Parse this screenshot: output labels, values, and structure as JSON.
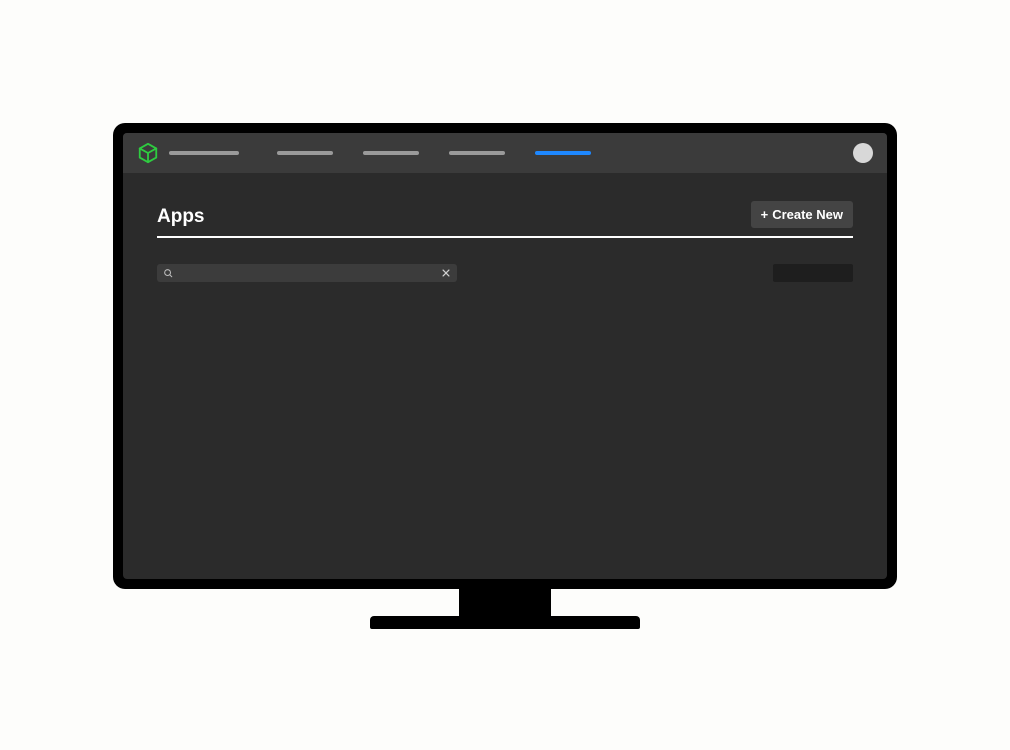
{
  "nav": {
    "items": [
      {
        "active": false
      },
      {
        "active": false
      },
      {
        "active": false
      },
      {
        "active": true
      }
    ]
  },
  "page": {
    "title": "Apps"
  },
  "actions": {
    "create_label": "Create New",
    "create_icon": "+"
  },
  "search": {
    "value": "",
    "placeholder": ""
  },
  "colors": {
    "accent": "#1e88ff",
    "logo": "#2ecc40",
    "bg_screen": "#2b2b2b",
    "bg_topbar": "#3b3b3b"
  }
}
